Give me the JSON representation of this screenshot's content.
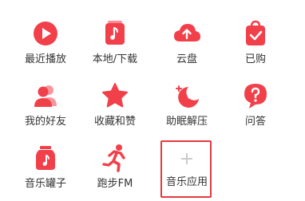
{
  "accent_color": "#f2404a",
  "items": [
    {
      "label": "最近播放",
      "icon": "play-circle-icon"
    },
    {
      "label": "本地/下载",
      "icon": "music-note-icon"
    },
    {
      "label": "云盘",
      "icon": "cloud-upload-icon"
    },
    {
      "label": "已购",
      "icon": "shopping-bag-check-icon"
    },
    {
      "label": "我的好友",
      "icon": "friends-icon"
    },
    {
      "label": "收藏和赞",
      "icon": "star-icon"
    },
    {
      "label": "助眠解压",
      "icon": "moon-icon"
    },
    {
      "label": "问答",
      "icon": "question-bubble-icon"
    },
    {
      "label": "音乐罐子",
      "icon": "music-jar-icon"
    },
    {
      "label": "跑步FM",
      "icon": "running-icon"
    },
    {
      "label": "音乐应用",
      "icon": "plus-icon"
    }
  ]
}
